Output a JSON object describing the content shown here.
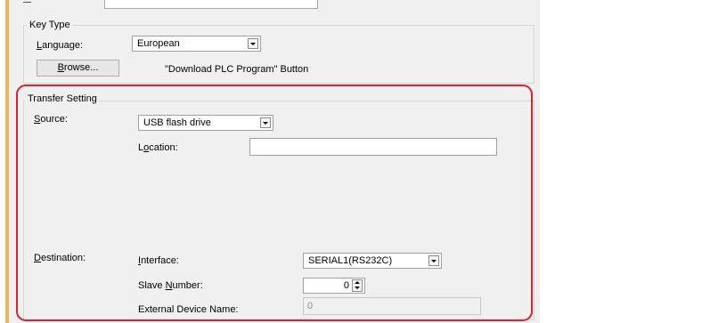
{
  "key_type": {
    "title": "Key Type",
    "language_label_pre": "",
    "language_label_ul": "L",
    "language_label_post": "anguage:",
    "language_value": "European",
    "browse_pre": "",
    "browse_ul": "B",
    "browse_post": "rowse...",
    "download_button_text": "\"Download PLC Program\" Button"
  },
  "transfer": {
    "title": "Transfer Setting",
    "source_label_pre": "",
    "source_label_ul": "S",
    "source_label_post": "ource:",
    "source_value": "USB flash drive",
    "location_label_pre": "L",
    "location_label_ul": "o",
    "location_label_post": "cation:",
    "location_value": "",
    "destination_label_pre": "",
    "destination_label_ul": "D",
    "destination_label_post": "estination:",
    "interface_label_pre": "",
    "interface_label_ul": "I",
    "interface_label_post": "nterface:",
    "interface_value": "SERIAL1(RS232C)",
    "slave_label_pre": "Slave ",
    "slave_label_ul": "N",
    "slave_label_post": "umber:",
    "slave_value": "0",
    "external_label": "External Device Name:",
    "external_value": "0"
  },
  "colors": {
    "highlight": "#e0202c",
    "left_strip": "#e8b85a"
  }
}
